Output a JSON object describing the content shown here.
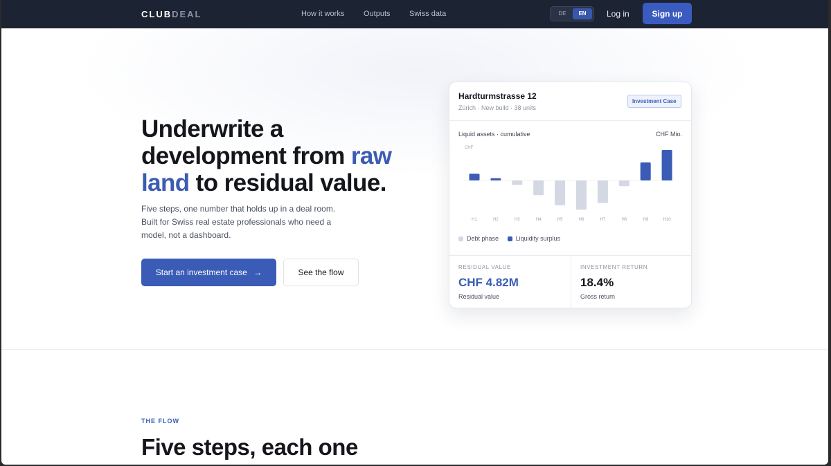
{
  "nav": {
    "logo_strong": "CLUB",
    "logo_dim": "DEAL",
    "links": [
      "How it works",
      "Outputs",
      "Swiss data"
    ],
    "lang": [
      "DE",
      "EN"
    ],
    "lang_active": "EN",
    "login": "Log in",
    "signup": "Sign up"
  },
  "hero": {
    "title_part1": "Underwrite a development from ",
    "title_accent": "raw land",
    "title_part2": " to residual value.",
    "subtitle": "Five steps, one number that holds up in a deal room. Built for Swiss real estate professionals who need a model, not a dashboard.",
    "primary_cta": "Start an investment case",
    "primary_cta_arrow": "→",
    "secondary_cta": "See the flow"
  },
  "card": {
    "title": "Hardturmstrasse 12",
    "meta": "Zürich · New build · 38 units",
    "badge": "Investment Case",
    "chart_label": "Liquid assets · cumulative",
    "chart_unit": "CHF Mio.",
    "legend": [
      "Debt phase",
      "Liquidity surplus"
    ],
    "stats": [
      {
        "caption": "RESIDUAL VALUE",
        "value": "CHF 4.82M",
        "sub": "Residual value"
      },
      {
        "caption": "INVESTMENT RETURN",
        "value": "18.4%",
        "sub": "Gross return"
      }
    ]
  },
  "colors": {
    "accent": "#3a5cb6",
    "debt": "#d3d8e2",
    "surplus": "#3a5cb6",
    "nav_bg": "#1c2333"
  },
  "chart_data": {
    "type": "bar",
    "categories": [
      "H1",
      "H2",
      "H3",
      "H4",
      "H5",
      "H6",
      "H7",
      "H8",
      "H9",
      "H10"
    ],
    "values": [
      0.6,
      0.2,
      -0.4,
      -1.3,
      -2.2,
      -2.6,
      -2.0,
      -0.5,
      1.6,
      2.7
    ],
    "series": [
      {
        "name": "Debt phase",
        "indices": [
          2,
          3,
          4,
          5,
          6,
          7
        ]
      },
      {
        "name": "Liquidity surplus",
        "indices": [
          0,
          1,
          8,
          9
        ]
      }
    ],
    "ylabel": "CHF",
    "ylim": [
      -3,
      3
    ],
    "grid": false,
    "legend": "bottom-left"
  },
  "flow": {
    "tag": "THE FLOW",
    "title": "Five steps, each one"
  }
}
